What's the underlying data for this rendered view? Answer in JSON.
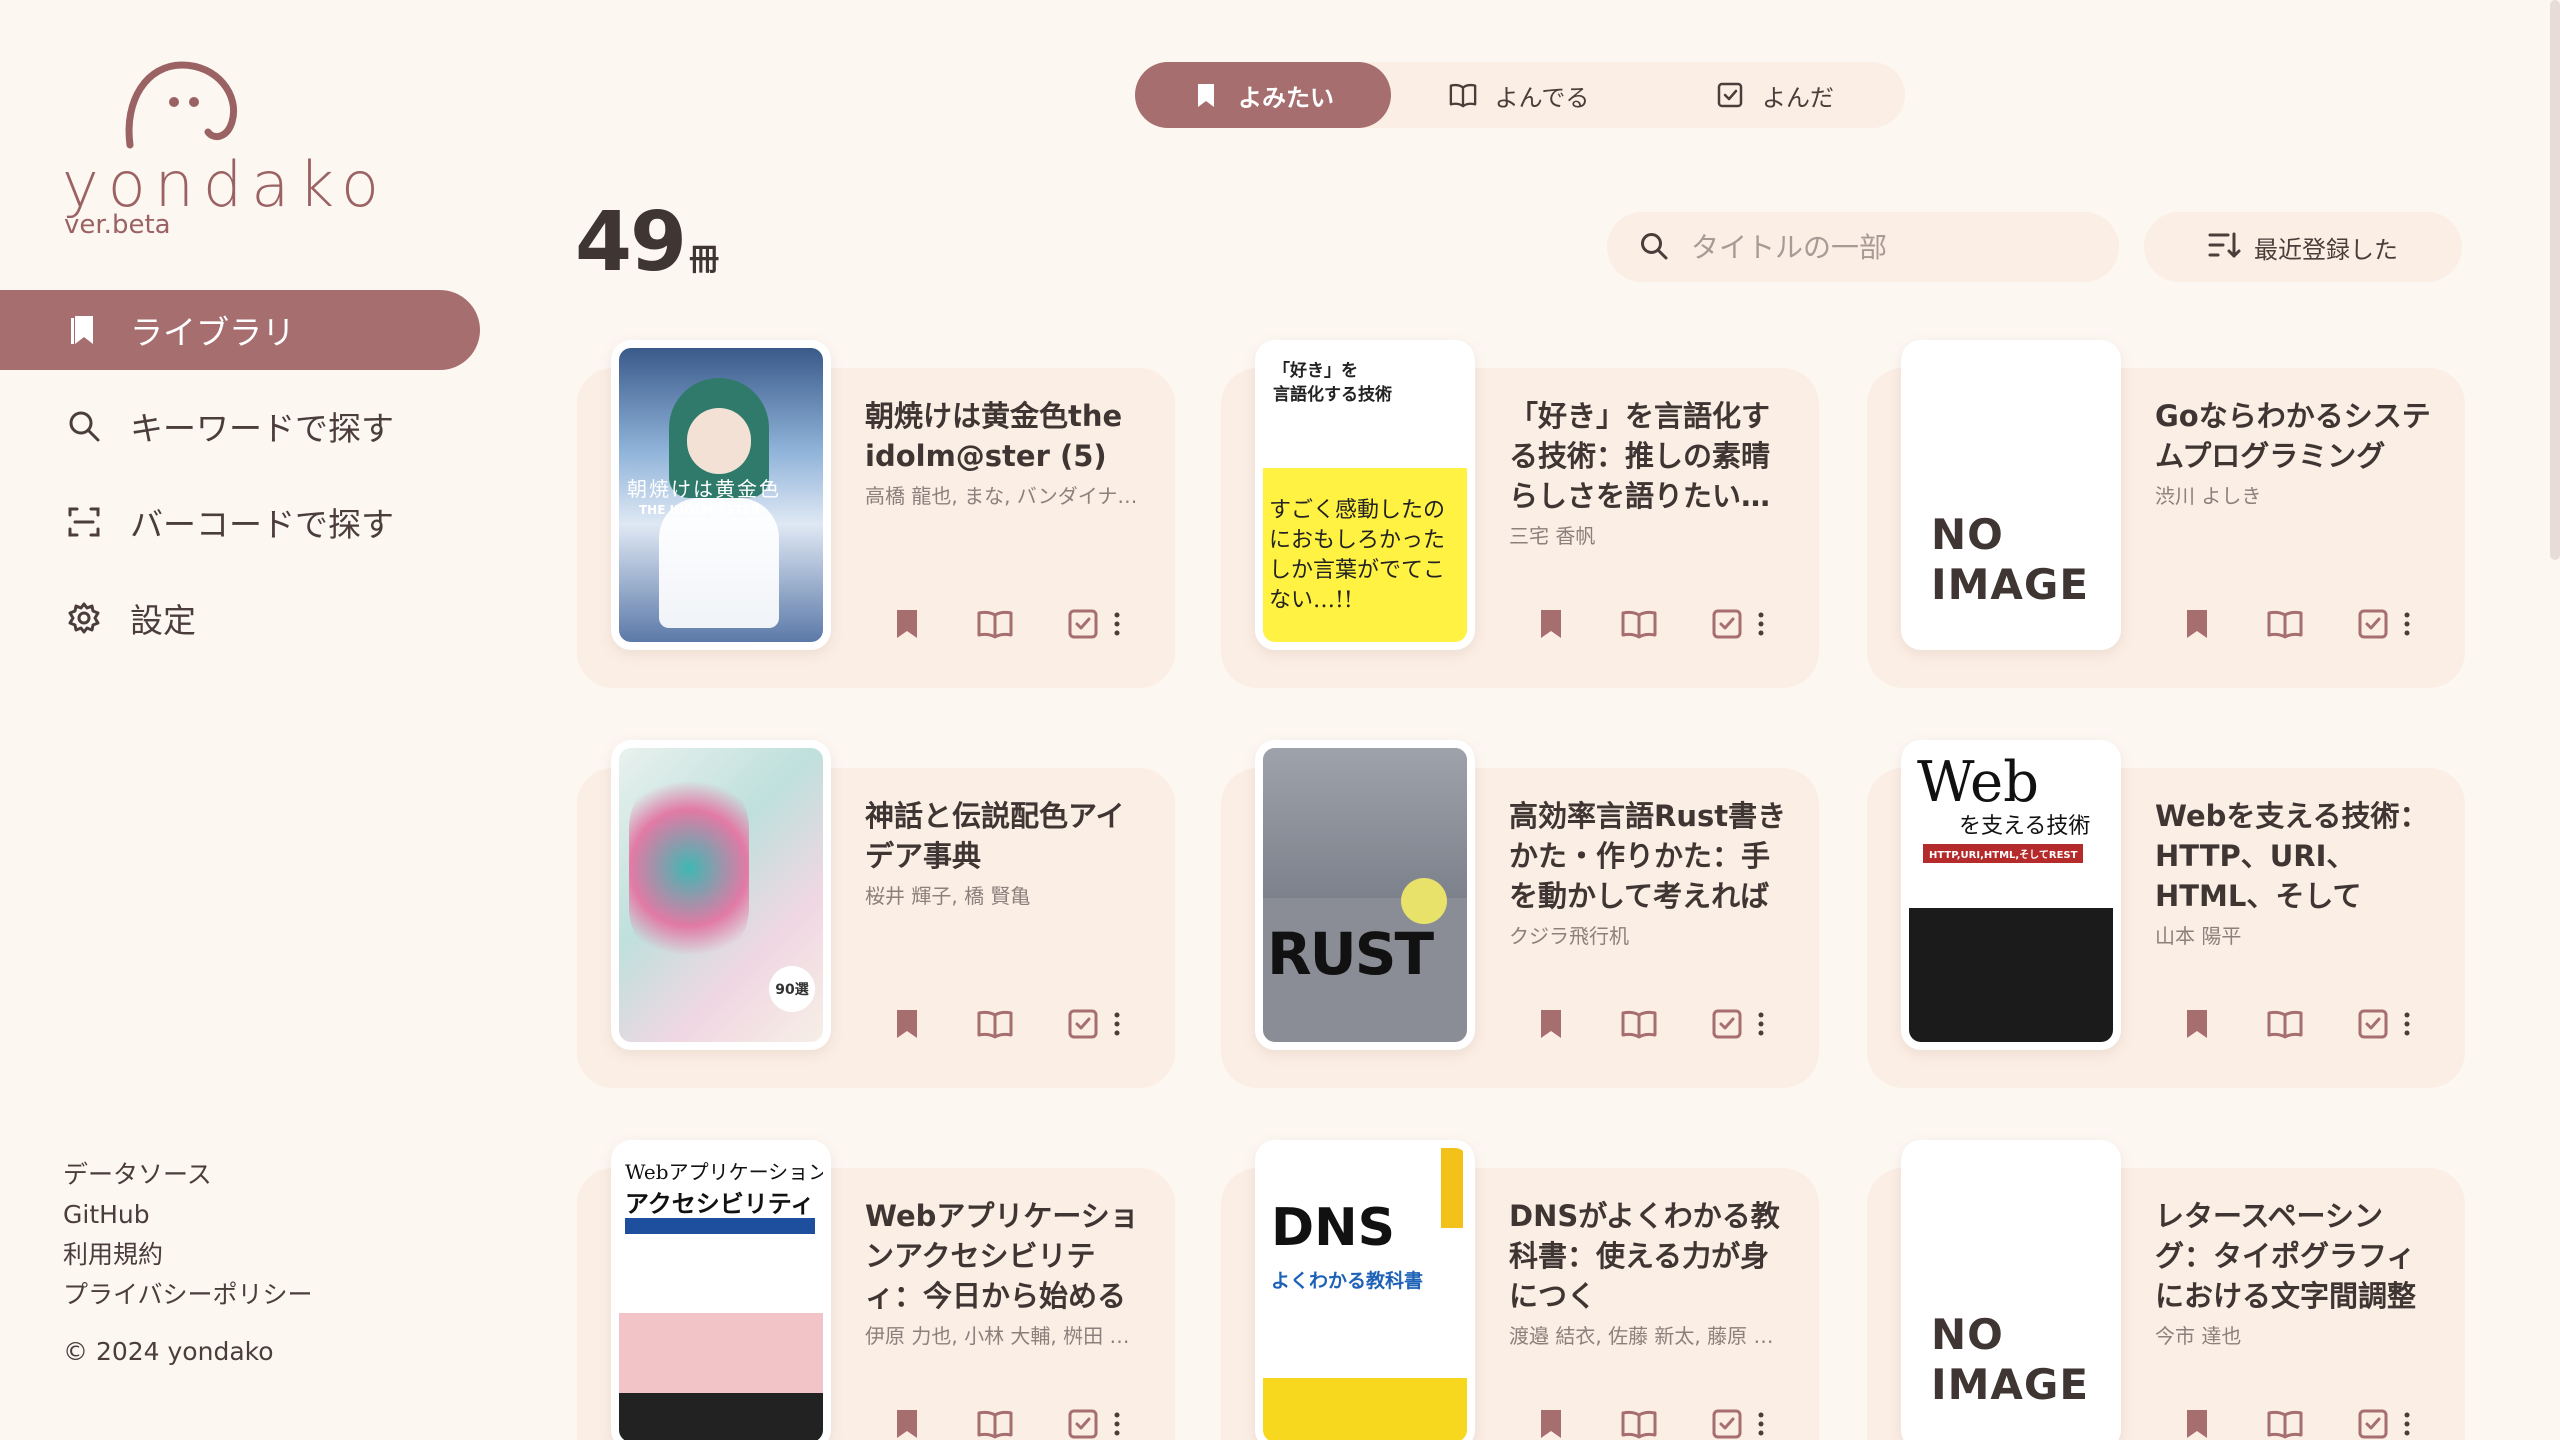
{
  "app": {
    "logo_text": "yondako",
    "version": "ver.beta",
    "accent": "#a66e6f"
  },
  "sidebar": {
    "items": [
      {
        "label": "ライブラリ",
        "icon": "library-bookmark-icon",
        "active": true
      },
      {
        "label": "キーワードで探す",
        "icon": "search-icon",
        "active": false
      },
      {
        "label": "バーコードで探す",
        "icon": "barcode-scan-icon",
        "active": false
      },
      {
        "label": "設定",
        "icon": "gear-icon",
        "active": false
      }
    ],
    "footer": {
      "links": [
        "データソース",
        "GitHub",
        "利用規約",
        "プライバシーポリシー"
      ],
      "copyright": "© 2024 yondako"
    }
  },
  "tabs": [
    {
      "label": "よみたい",
      "icon": "bookmark-icon",
      "active": true
    },
    {
      "label": "よんでる",
      "icon": "open-book-icon",
      "active": false
    },
    {
      "label": "よんだ",
      "icon": "checkbox-icon",
      "active": false
    }
  ],
  "library": {
    "count": "49",
    "count_unit": "冊",
    "search_placeholder": "タイトルの一部",
    "sort_label": "最近登録した"
  },
  "books": [
    {
      "title": "朝焼けは黄金色the idolm@ster (5)",
      "author": "高橋 龍也, まな, バンダイナ…",
      "cover": "image"
    },
    {
      "title": "「好き」を言語化する技術：推しの素晴らしさを語りたい…",
      "author": "三宅 香帆",
      "cover": "image"
    },
    {
      "title": "Goならわかるシステムプログラミング",
      "author": "渋川 よしき",
      "cover": "none"
    },
    {
      "title": "神話と伝説配色アイデア事典",
      "author": "桜井 輝子, 橋 賢亀",
      "cover": "image"
    },
    {
      "title": "高効率言語Rust書きかた・作りかた：手を動かして考えればよ…",
      "author": "クジラ飛行机",
      "cover": "image"
    },
    {
      "title": "Webを支える技術：HTTP、URI、HTML、そしてREST",
      "author": "山本 陽平",
      "cover": "image"
    },
    {
      "title": "Webアプリケーションアクセシビリティ：今日から始める現…",
      "author": "伊原 力也, 小林 大輔, 桝田 …",
      "cover": "image"
    },
    {
      "title": "DNSがよくわかる教科書：使える力が身につく",
      "author": "渡邉 結衣, 佐藤 新太, 藤原 …",
      "cover": "image"
    },
    {
      "title": "レタースペーシング：タイポグラフィにおける文字間調整の考…",
      "author": "今市 達也",
      "cover": "none"
    }
  ],
  "cover_texts": {
    "no_image": "NO IMAGE",
    "dns_title": "DNS",
    "dns_sub": "よくわかる教科書",
    "rust_title": "RUST",
    "web_title": "Web",
    "web_sub": "を支える技術",
    "web_series": "HTTP,URI,HTML,そしてREST",
    "a11y_title": "Webアプリケーション",
    "a11y_title2": "アクセシビリティ",
    "suki_title": "「好き」を",
    "suki_title2": "言語化する技術",
    "suki_catch": "すごく感動したのにおもしろかったしか言葉がでてこない…!!",
    "idol_title": "朝焼けは黄金色",
    "idol_series": "THE IDOLM@STER",
    "myth_num": "90選"
  }
}
